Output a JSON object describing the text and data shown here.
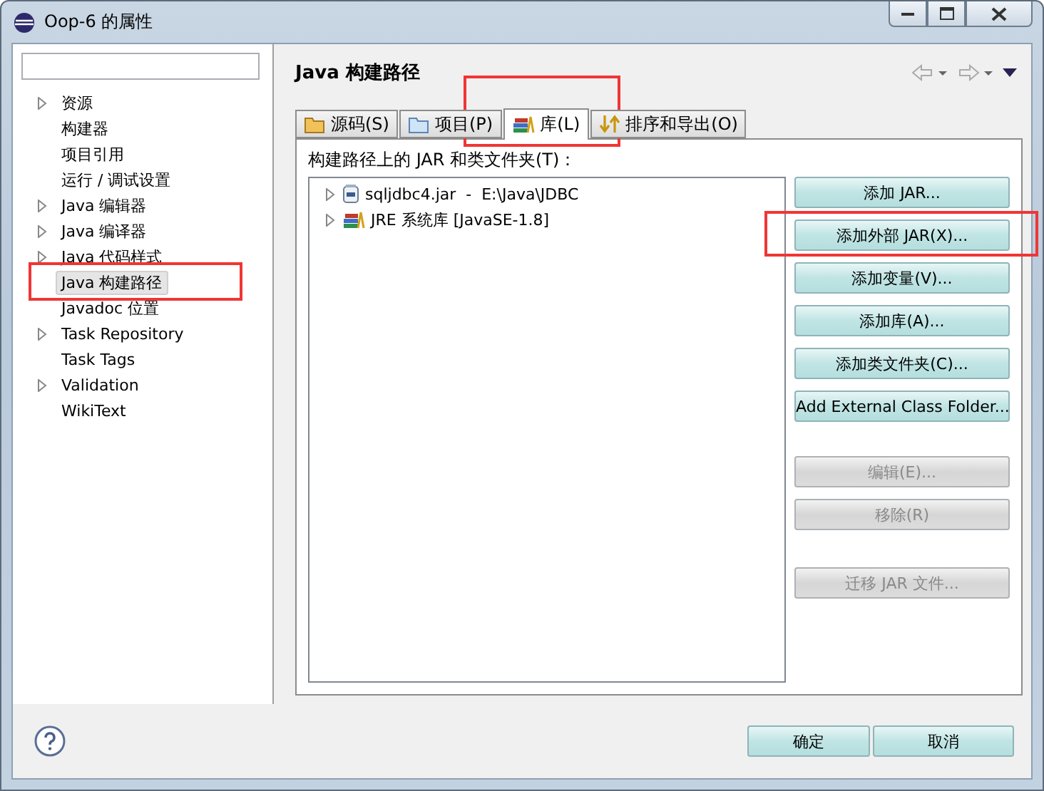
{
  "window": {
    "title": "Oop-6 的属性"
  },
  "nav_items": [
    {
      "label": "资源",
      "expandable": true,
      "selected": false
    },
    {
      "label": "构建器",
      "expandable": false,
      "selected": false
    },
    {
      "label": "项目引用",
      "expandable": false,
      "selected": false
    },
    {
      "label": "运行 / 调试设置",
      "expandable": false,
      "selected": false
    },
    {
      "label": "Java 编辑器",
      "expandable": true,
      "selected": false
    },
    {
      "label": "Java 编译器",
      "expandable": true,
      "selected": false
    },
    {
      "label": "Java 代码样式",
      "expandable": true,
      "selected": false
    },
    {
      "label": "Java 构建路径",
      "expandable": false,
      "selected": true
    },
    {
      "label": "Javadoc 位置",
      "expandable": false,
      "selected": false
    },
    {
      "label": "Task Repository",
      "expandable": true,
      "selected": false
    },
    {
      "label": "Task Tags",
      "expandable": false,
      "selected": false
    },
    {
      "label": "Validation",
      "expandable": true,
      "selected": false
    },
    {
      "label": "WikiText",
      "expandable": false,
      "selected": false
    }
  ],
  "page": {
    "title": "Java 构建路径"
  },
  "tabs": [
    {
      "label": "源码(S)",
      "kind": "source",
      "selected": false
    },
    {
      "label": "项目(P)",
      "kind": "project",
      "selected": false
    },
    {
      "label": "库(L)",
      "kind": "library",
      "selected": true
    },
    {
      "label": "排序和导出(O)",
      "kind": "order",
      "selected": false
    }
  ],
  "list_label": "构建路径上的 JAR 和类文件夹(T)：",
  "entries": [
    {
      "label": "sqljdbc4.jar  -  E:\\Java\\JDBC",
      "kind": "jar",
      "expandable": true
    },
    {
      "label": "JRE 系统库 [JavaSE-1.8]",
      "kind": "library",
      "expandable": true
    }
  ],
  "buttons": [
    {
      "label": "添加 JAR...",
      "disabled": false
    },
    {
      "label": "添加外部 JAR(X)...",
      "disabled": false
    },
    {
      "label": "添加变量(V)...",
      "disabled": false
    },
    {
      "label": "添加库(A)...",
      "disabled": false
    },
    {
      "label": "添加类文件夹(C)...",
      "disabled": false
    },
    {
      "label": "Add External Class Folder...",
      "disabled": false
    },
    {
      "label": "编辑(E)...",
      "disabled": true
    },
    {
      "label": "移除(R)",
      "disabled": true
    },
    {
      "label": "迁移 JAR 文件...",
      "disabled": true
    }
  ],
  "footer": {
    "ok": "确定",
    "cancel": "取消"
  }
}
